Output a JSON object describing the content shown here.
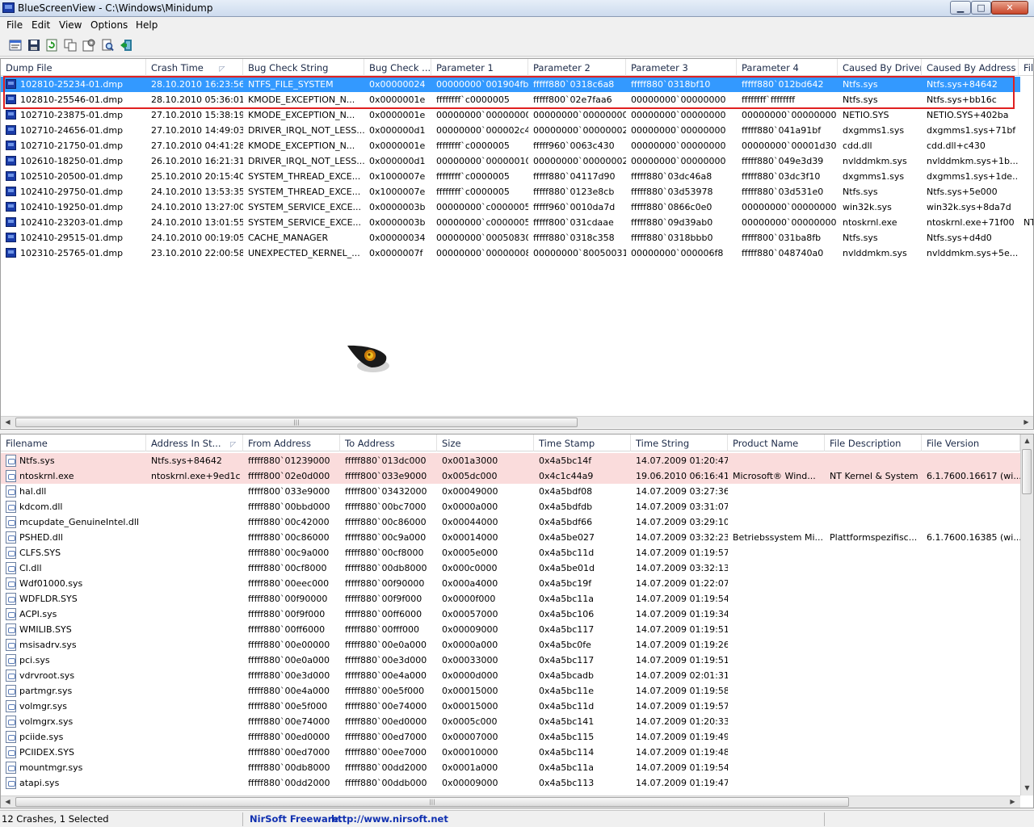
{
  "window": {
    "title": "BlueScreenView  -  C:\\Windows\\Minidump",
    "min_glyph": "▁",
    "max_glyph": "□",
    "close_glyph": "✕"
  },
  "menu": [
    "File",
    "Edit",
    "View",
    "Options",
    "Help"
  ],
  "toolbar": {
    "icons": [
      "properties-icon",
      "save-icon",
      "refresh-icon",
      "copy-icon",
      "advanced-options-icon",
      "find-icon",
      "exit-icon"
    ]
  },
  "crashes": {
    "columns": [
      "Dump File",
      "Crash Time",
      "Bug Check String",
      "Bug Check ...",
      "Parameter 1",
      "Parameter 2",
      "Parameter 3",
      "Parameter 4",
      "Caused By Driver",
      "Caused By Address",
      "Fil"
    ],
    "sort_indicator": "◸",
    "rows": [
      [
        "102810-25234-01.dmp",
        "28.10.2010 16:23:56",
        "NTFS_FILE_SYSTEM",
        "0x00000024",
        "00000000`001904fb",
        "fffff880`0318c6a8",
        "fffff880`0318bf10",
        "fffff880`012bd642",
        "Ntfs.sys",
        "Ntfs.sys+84642",
        ""
      ],
      [
        "102810-25546-01.dmp",
        "28.10.2010 05:36:01",
        "KMODE_EXCEPTION_N...",
        "0x0000001e",
        "ffffffff`c0000005",
        "fffff800`02e7faa6",
        "00000000`00000000",
        "ffffffff`ffffffff",
        "Ntfs.sys",
        "Ntfs.sys+bb16c",
        ""
      ],
      [
        "102710-23875-01.dmp",
        "27.10.2010 15:38:19",
        "KMODE_EXCEPTION_N...",
        "0x0000001e",
        "00000000`00000000",
        "00000000`00000000",
        "00000000`00000000",
        "00000000`00000000",
        "NETIO.SYS",
        "NETIO.SYS+402ba",
        ""
      ],
      [
        "102710-24656-01.dmp",
        "27.10.2010 14:49:03",
        "DRIVER_IRQL_NOT_LESS...",
        "0x000000d1",
        "00000000`000002c4",
        "00000000`00000002",
        "00000000`00000000",
        "fffff880`041a91bf",
        "dxgmms1.sys",
        "dxgmms1.sys+71bf",
        ""
      ],
      [
        "102710-21750-01.dmp",
        "27.10.2010 04:41:28",
        "KMODE_EXCEPTION_N...",
        "0x0000001e",
        "ffffffff`c0000005",
        "fffff960`0063c430",
        "00000000`00000000",
        "00000000`00001d30",
        "cdd.dll",
        "cdd.dll+c430",
        ""
      ],
      [
        "102610-18250-01.dmp",
        "26.10.2010 16:21:31",
        "DRIVER_IRQL_NOT_LESS...",
        "0x000000d1",
        "00000000`00000010",
        "00000000`00000002",
        "00000000`00000000",
        "fffff880`049e3d39",
        "nvlddmkm.sys",
        "nvlddmkm.sys+1b...",
        ""
      ],
      [
        "102510-20500-01.dmp",
        "25.10.2010 20:15:40",
        "SYSTEM_THREAD_EXCE...",
        "0x1000007e",
        "ffffffff`c0000005",
        "fffff880`04117d90",
        "fffff880`03dc46a8",
        "fffff880`03dc3f10",
        "dxgmms1.sys",
        "dxgmms1.sys+1de...",
        ""
      ],
      [
        "102410-29750-01.dmp",
        "24.10.2010 13:53:35",
        "SYSTEM_THREAD_EXCE...",
        "0x1000007e",
        "ffffffff`c0000005",
        "fffff880`0123e8cb",
        "fffff880`03d53978",
        "fffff880`03d531e0",
        "Ntfs.sys",
        "Ntfs.sys+5e000",
        ""
      ],
      [
        "102410-19250-01.dmp",
        "24.10.2010 13:27:00",
        "SYSTEM_SERVICE_EXCE...",
        "0x0000003b",
        "00000000`c0000005",
        "fffff960`0010da7d",
        "fffff880`0866c0e0",
        "00000000`00000000",
        "win32k.sys",
        "win32k.sys+8da7d",
        ""
      ],
      [
        "102410-23203-01.dmp",
        "24.10.2010 13:01:55",
        "SYSTEM_SERVICE_EXCE...",
        "0x0000003b",
        "00000000`c0000005",
        "fffff800`031cdaae",
        "fffff880`09d39ab0",
        "00000000`00000000",
        "ntoskrnl.exe",
        "ntoskrnl.exe+71f00",
        "NT"
      ],
      [
        "102410-29515-01.dmp",
        "24.10.2010 00:19:05",
        "CACHE_MANAGER",
        "0x00000034",
        "00000000`00050830",
        "fffff880`0318c358",
        "fffff880`0318bbb0",
        "fffff800`031ba8fb",
        "Ntfs.sys",
        "Ntfs.sys+d4d0",
        ""
      ],
      [
        "102310-25765-01.dmp",
        "23.10.2010 22:00:58",
        "UNEXPECTED_KERNEL_...",
        "0x0000007f",
        "00000000`00000008",
        "00000000`80050031",
        "00000000`000006f8",
        "fffff880`048740a0",
        "nvlddmkm.sys",
        "nvlddmkm.sys+5e...",
        ""
      ]
    ]
  },
  "drivers": {
    "columns": [
      "Filename",
      "Address In St...",
      "From Address",
      "To Address",
      "Size",
      "Time Stamp",
      "Time String",
      "Product Name",
      "File Description",
      "File Version"
    ],
    "sort_indicator": "◸",
    "rows": [
      [
        "Ntfs.sys",
        "Ntfs.sys+84642",
        "fffff880`01239000",
        "fffff880`013dc000",
        "0x001a3000",
        "0x4a5bc14f",
        "14.07.2009 01:20:47",
        "",
        "",
        ""
      ],
      [
        "ntoskrnl.exe",
        "ntoskrnl.exe+9ed1c",
        "fffff800`02e0d000",
        "fffff800`033e9000",
        "0x005dc000",
        "0x4c1c44a9",
        "19.06.2010 06:16:41",
        "Microsoft® Wind...",
        "NT Kernel & System",
        "6.1.7600.16617 (wi..."
      ],
      [
        "hal.dll",
        "",
        "fffff800`033e9000",
        "fffff800`03432000",
        "0x00049000",
        "0x4a5bdf08",
        "14.07.2009 03:27:36",
        "",
        "",
        ""
      ],
      [
        "kdcom.dll",
        "",
        "fffff880`00bbd000",
        "fffff880`00bc7000",
        "0x0000a000",
        "0x4a5bdfdb",
        "14.07.2009 03:31:07",
        "",
        "",
        ""
      ],
      [
        "mcupdate_GenuineIntel.dll",
        "",
        "fffff880`00c42000",
        "fffff880`00c86000",
        "0x00044000",
        "0x4a5bdf66",
        "14.07.2009 03:29:10",
        "",
        "",
        ""
      ],
      [
        "PSHED.dll",
        "",
        "fffff880`00c86000",
        "fffff880`00c9a000",
        "0x00014000",
        "0x4a5be027",
        "14.07.2009 03:32:23",
        "Betriebssystem Mi...",
        "Plattformspezifisc...",
        "6.1.7600.16385 (wi..."
      ],
      [
        "CLFS.SYS",
        "",
        "fffff880`00c9a000",
        "fffff880`00cf8000",
        "0x0005e000",
        "0x4a5bc11d",
        "14.07.2009 01:19:57",
        "",
        "",
        ""
      ],
      [
        "CI.dll",
        "",
        "fffff880`00cf8000",
        "fffff880`00db8000",
        "0x000c0000",
        "0x4a5be01d",
        "14.07.2009 03:32:13",
        "",
        "",
        ""
      ],
      [
        "Wdf01000.sys",
        "",
        "fffff880`00eec000",
        "fffff880`00f90000",
        "0x000a4000",
        "0x4a5bc19f",
        "14.07.2009 01:22:07",
        "",
        "",
        ""
      ],
      [
        "WDFLDR.SYS",
        "",
        "fffff880`00f90000",
        "fffff880`00f9f000",
        "0x0000f000",
        "0x4a5bc11a",
        "14.07.2009 01:19:54",
        "",
        "",
        ""
      ],
      [
        "ACPI.sys",
        "",
        "fffff880`00f9f000",
        "fffff880`00ff6000",
        "0x00057000",
        "0x4a5bc106",
        "14.07.2009 01:19:34",
        "",
        "",
        ""
      ],
      [
        "WMILIB.SYS",
        "",
        "fffff880`00ff6000",
        "fffff880`00fff000",
        "0x00009000",
        "0x4a5bc117",
        "14.07.2009 01:19:51",
        "",
        "",
        ""
      ],
      [
        "msisadrv.sys",
        "",
        "fffff880`00e00000",
        "fffff880`00e0a000",
        "0x0000a000",
        "0x4a5bc0fe",
        "14.07.2009 01:19:26",
        "",
        "",
        ""
      ],
      [
        "pci.sys",
        "",
        "fffff880`00e0a000",
        "fffff880`00e3d000",
        "0x00033000",
        "0x4a5bc117",
        "14.07.2009 01:19:51",
        "",
        "",
        ""
      ],
      [
        "vdrvroot.sys",
        "",
        "fffff880`00e3d000",
        "fffff880`00e4a000",
        "0x0000d000",
        "0x4a5bcadb",
        "14.07.2009 02:01:31",
        "",
        "",
        ""
      ],
      [
        "partmgr.sys",
        "",
        "fffff880`00e4a000",
        "fffff880`00e5f000",
        "0x00015000",
        "0x4a5bc11e",
        "14.07.2009 01:19:58",
        "",
        "",
        ""
      ],
      [
        "volmgr.sys",
        "",
        "fffff880`00e5f000",
        "fffff880`00e74000",
        "0x00015000",
        "0x4a5bc11d",
        "14.07.2009 01:19:57",
        "",
        "",
        ""
      ],
      [
        "volmgrx.sys",
        "",
        "fffff880`00e74000",
        "fffff880`00ed0000",
        "0x0005c000",
        "0x4a5bc141",
        "14.07.2009 01:20:33",
        "",
        "",
        ""
      ],
      [
        "pciide.sys",
        "",
        "fffff880`00ed0000",
        "fffff880`00ed7000",
        "0x00007000",
        "0x4a5bc115",
        "14.07.2009 01:19:49",
        "",
        "",
        ""
      ],
      [
        "PCIIDEX.SYS",
        "",
        "fffff880`00ed7000",
        "fffff880`00ee7000",
        "0x00010000",
        "0x4a5bc114",
        "14.07.2009 01:19:48",
        "",
        "",
        ""
      ],
      [
        "mountmgr.sys",
        "",
        "fffff880`00db8000",
        "fffff880`00dd2000",
        "0x0001a000",
        "0x4a5bc11a",
        "14.07.2009 01:19:54",
        "",
        "",
        ""
      ],
      [
        "atapi.sys",
        "",
        "fffff880`00dd2000",
        "fffff880`00ddb000",
        "0x00009000",
        "0x4a5bc113",
        "14.07.2009 01:19:47",
        "",
        "",
        ""
      ]
    ]
  },
  "scroll": {
    "left_arrow": "◀",
    "right_arrow": "▶",
    "up_arrow": "▲",
    "down_arrow": "▼",
    "grip": "|||"
  },
  "status": {
    "summary": "12 Crashes, 1 Selected",
    "freeware_label": "NirSoft Freeware.",
    "url": "http://www.nirsoft.net"
  },
  "colors": {
    "selection": "#3399ff",
    "highlight_row": "#fadcdc",
    "annotation_box": "#e02020",
    "link": "#1030b0"
  }
}
